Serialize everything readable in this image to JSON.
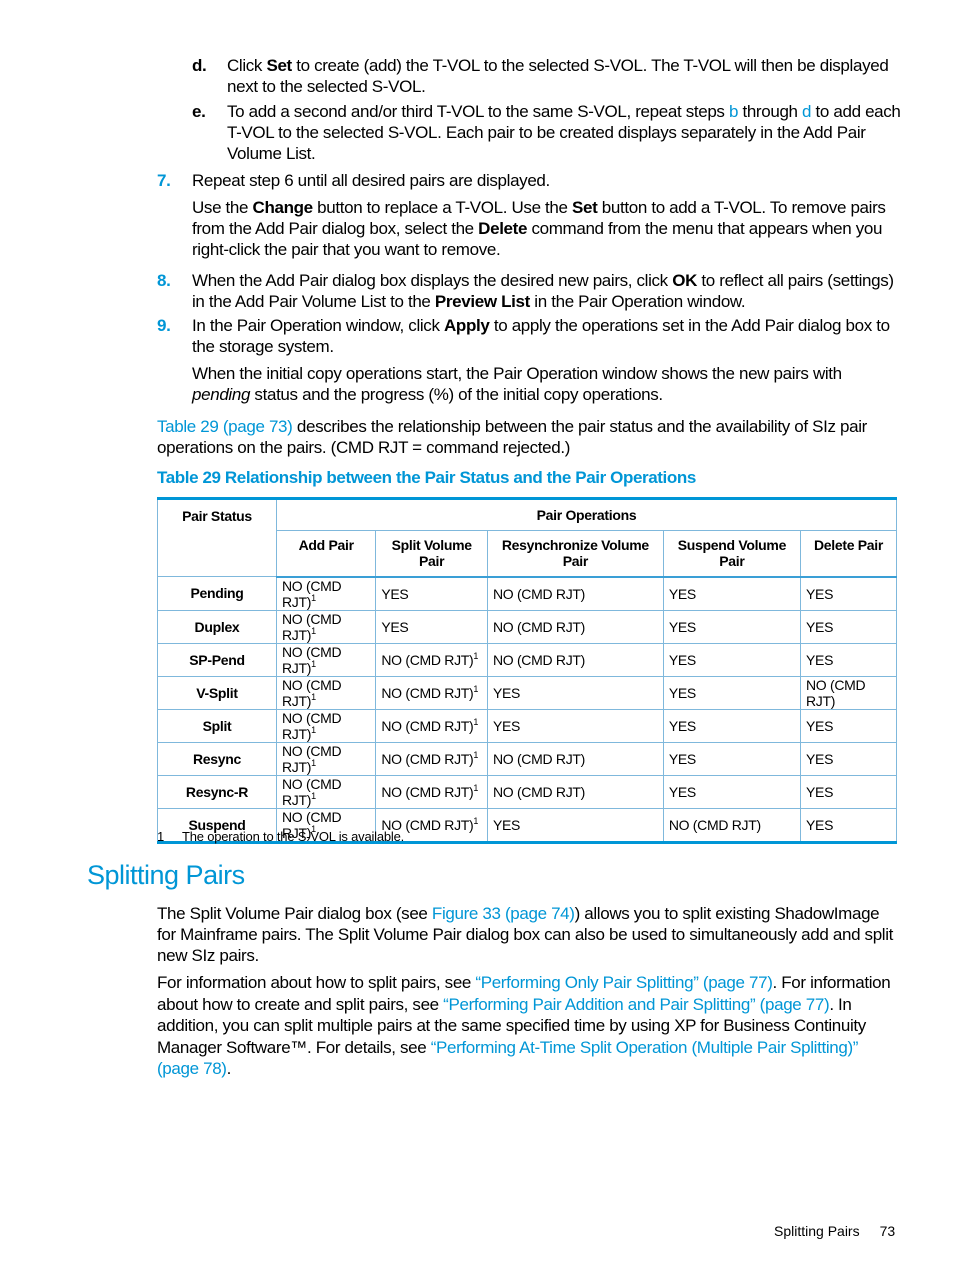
{
  "steps": {
    "d": {
      "label": "d.",
      "parts": [
        "Click ",
        "Set",
        " to create (add) the T-VOL to the selected S-VOL. The T-VOL will then be displayed next to the selected S-VOL."
      ]
    },
    "e": {
      "label": "e.",
      "parts": [
        "To add a second and/or third T-VOL to the same S-VOL, repeat steps ",
        "b",
        " through ",
        "d",
        " to add each T-VOL to the selected S-VOL. Each pair to be created displays separately in the Add Pair Volume List."
      ]
    },
    "s7": {
      "label": "7.",
      "text": "Repeat step 6 until all desired pairs are displayed.",
      "note_parts": [
        "Use the ",
        "Change",
        " button to replace a T-VOL. Use the ",
        "Set",
        " button to add a T-VOL. To remove pairs from the Add Pair dialog box, select the ",
        "Delete",
        " command from the menu that appears when you right-click the pair that you want to remove."
      ]
    },
    "s8": {
      "label": "8.",
      "parts": [
        "When the Add Pair dialog box displays the desired new pairs, click ",
        "OK",
        " to reflect all pairs (settings) in the Add Pair Volume List to the ",
        "Preview List",
        " in the Pair Operation window."
      ]
    },
    "s9": {
      "label": "9.",
      "parts": [
        "In the Pair Operation window, click ",
        "Apply",
        " to apply the operations set in the Add Pair dialog box to the storage system."
      ],
      "note_parts": [
        "When the initial copy operations start, the Pair Operation window shows the new pairs with ",
        "pending",
        " status and the progress (%) of the initial copy operations."
      ]
    }
  },
  "intro": {
    "link": "Table 29 (page 73)",
    "text": " describes the relationship between the pair status and the availability of SIz pair operations on the pairs. (CMD RJT = command rejected.)"
  },
  "table": {
    "caption": "Table 29 Relationship between the Pair Status and the Pair Operations",
    "header_status": "Pair Status",
    "header_group": "Pair Operations",
    "columns": [
      "Add Pair",
      "Split Volume Pair",
      "Resynchronize Volume Pair",
      "Suspend Volume Pair",
      "Delete Pair"
    ],
    "rows": [
      {
        "status": "Pending",
        "cells": [
          "NO (CMD RJT)|1",
          "YES",
          "NO (CMD RJT)",
          "YES",
          "YES"
        ]
      },
      {
        "status": "Duplex",
        "cells": [
          "NO (CMD RJT)|1",
          "YES",
          "NO (CMD RJT)",
          "YES",
          "YES"
        ]
      },
      {
        "status": "SP-Pend",
        "cells": [
          "NO (CMD RJT)|1",
          "NO (CMD RJT)|1",
          "NO (CMD RJT)",
          "YES",
          "YES"
        ]
      },
      {
        "status": "V-Split",
        "cells": [
          "NO (CMD RJT)|1",
          "NO (CMD RJT)|1",
          "YES",
          "YES",
          "NO (CMD RJT)"
        ]
      },
      {
        "status": "Split",
        "cells": [
          "NO (CMD RJT)|1",
          "NO (CMD RJT)|1",
          "YES",
          "YES",
          "YES"
        ]
      },
      {
        "status": "Resync",
        "cells": [
          "NO (CMD RJT)|1",
          "NO (CMD RJT)|1",
          "NO (CMD RJT)",
          "YES",
          "YES"
        ]
      },
      {
        "status": "Resync-R",
        "cells": [
          "NO (CMD RJT)|1",
          "NO (CMD RJT)|1",
          "NO (CMD RJT)",
          "YES",
          "YES"
        ]
      },
      {
        "status": "Suspend",
        "cells": [
          "NO (CMD RJT)|1",
          "NO (CMD RJT)|1",
          "YES",
          "NO (CMD RJT)",
          "YES"
        ]
      }
    ],
    "footnote_num": "1",
    "footnote_text": "The operation to the S-VOL is available."
  },
  "section": {
    "title": "Splitting Pairs",
    "p1": [
      "The Split Volume Pair dialog box (see ",
      "Figure 33 (page 74)",
      ") allows you to split existing ShadowImage for Mainframe pairs. The Split Volume Pair dialog box can also be used to simultaneously add and split new SIz pairs."
    ],
    "p2": [
      "For information about how to split pairs, see ",
      "“Performing Only Pair Splitting” (page 77)",
      ". For information about how to create and split pairs, see ",
      "“Performing Pair Addition and Pair Splitting” (page 77)",
      ". In addition, you can split multiple pairs at the same specified time by using XP for Business Continuity Manager Software™. For details, see ",
      "“Performing At-Time Split Operation (Multiple Pair Splitting)” (page 78)",
      "."
    ]
  },
  "footer": {
    "section": "Splitting Pairs",
    "page": "73"
  },
  "colors": {
    "accent": "#0096d6",
    "table_rule": "#7fb8dc"
  }
}
